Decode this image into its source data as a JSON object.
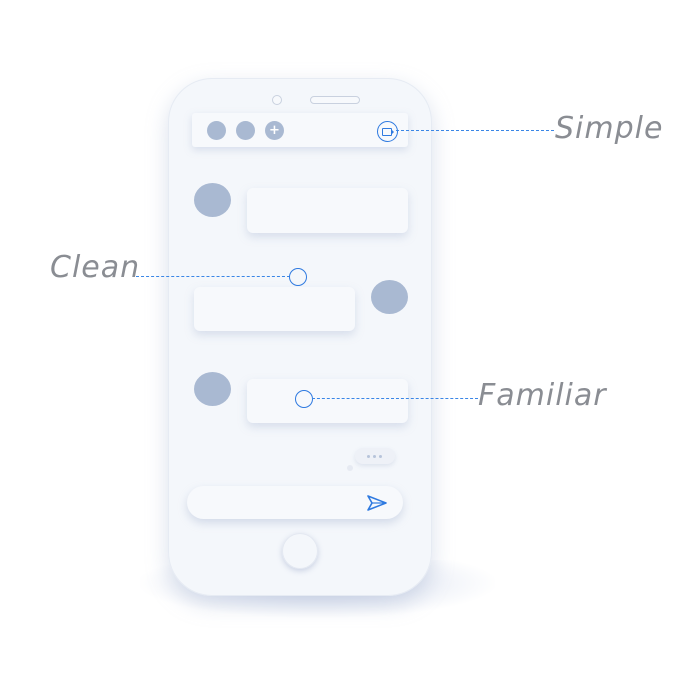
{
  "callouts": {
    "simple": "Simple",
    "clean": "Clean",
    "familiar": "Familiar"
  },
  "topbar": {
    "icons": [
      "avatar-dot",
      "avatar-dot",
      "plus-icon",
      "video-icon"
    ],
    "plus_glyph": "+"
  },
  "messages": [
    {
      "side": "left"
    },
    {
      "side": "right"
    },
    {
      "side": "left"
    }
  ],
  "input": {
    "value": "",
    "placeholder": "",
    "send_icon": "send-icon"
  },
  "colors": {
    "accent": "#2f7ae0",
    "avatar": "#a9b9d2",
    "phone": "#f4f7fb",
    "label": "#8a8d93"
  }
}
